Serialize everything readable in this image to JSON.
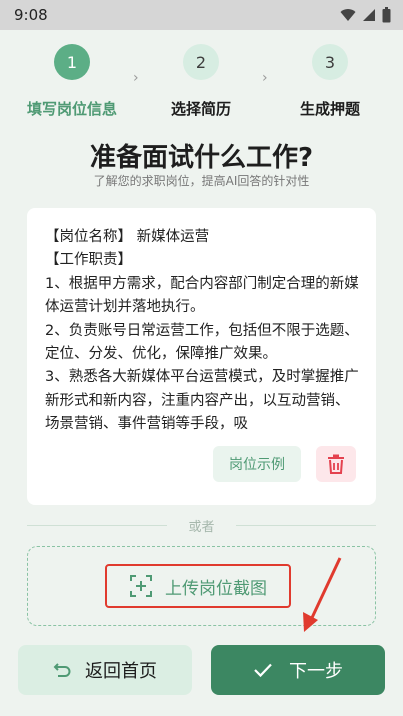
{
  "status_bar": {
    "time": "9:08"
  },
  "stepper": {
    "steps": [
      {
        "number": "1",
        "label": "填写岗位信息"
      },
      {
        "number": "2",
        "label": "选择简历"
      },
      {
        "number": "3",
        "label": "生成押题"
      }
    ],
    "arrow": "›"
  },
  "header": {
    "title": "准备面试什么工作?",
    "subtitle": "了解您的求职岗位，提高AI回答的针对性"
  },
  "job_card": {
    "lines": [
      "【岗位名称】 新媒体运营",
      "【工作职责】",
      "1、根据甲方需求，配合内容部门制定合理的新媒体运营计划并落地执行。",
      "2、负责账号日常运营工作，包括但不限于选题、定位、分发、优化，保障推广效果。",
      "3、熟悉各大新媒体平台运营模式，及时掌握推广新形式和新内容，注重内容产出，以互动营销、场景营销、事件营销等手段，吸"
    ],
    "sample_button": "岗位示例"
  },
  "divider_text": "或者",
  "upload": {
    "label": "上传岗位截图"
  },
  "footer": {
    "back_label": "返回首页",
    "next_label": "下一步"
  },
  "colors": {
    "accent": "#4f9a74",
    "primary_button": "#3c8762",
    "highlight_red": "#e03a2e"
  },
  "icons": [
    "wifi-icon",
    "signal-icon",
    "battery-icon",
    "trash-icon",
    "add-image-icon",
    "back-arrow-icon",
    "check-icon"
  ]
}
